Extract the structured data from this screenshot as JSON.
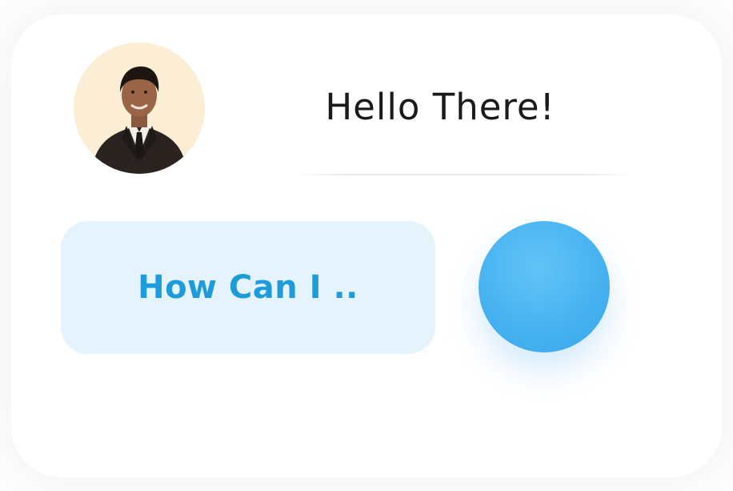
{
  "chat": {
    "greeting": "Hello There!",
    "input_text": "How Can I ..",
    "avatar_icon": "user-avatar-photo",
    "send_button_icon": "send-button-circle"
  },
  "colors": {
    "bubble_background": "#e5f3fd",
    "bubble_text": "#1e9bd9",
    "send_button": "#45b1f0",
    "greeting_text": "#1a1a1a"
  }
}
